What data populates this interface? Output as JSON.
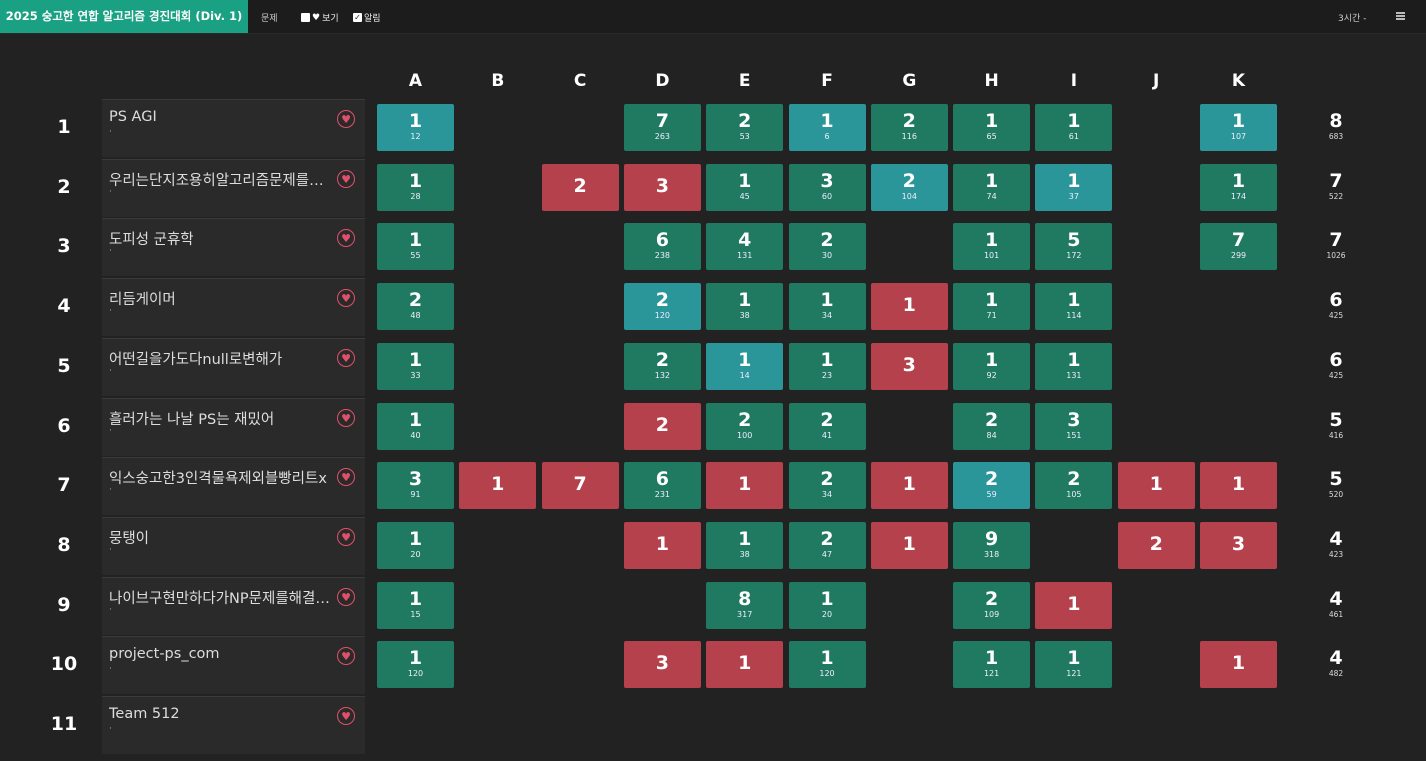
{
  "header": {
    "contest_title": "2025 숭고한 연합 알고리즘 경진대회 (Div. 1)",
    "problems_label": "문제",
    "view_label": "보기",
    "alert_label": "알림",
    "time_select": "3시간 -"
  },
  "problems": [
    "A",
    "B",
    "C",
    "D",
    "E",
    "F",
    "G",
    "H",
    "I",
    "J",
    "K"
  ],
  "rows": [
    {
      "rank": "1",
      "team": "PS AGI",
      "sub": "·",
      "solved": "8",
      "penalty": "683",
      "cells": [
        {
          "s": "first",
          "t": "1",
          "m": "12"
        },
        null,
        null,
        {
          "s": "solved",
          "t": "7",
          "m": "263"
        },
        {
          "s": "solved",
          "t": "2",
          "m": "53"
        },
        {
          "s": "first",
          "t": "1",
          "m": "6"
        },
        {
          "s": "solved",
          "t": "2",
          "m": "116"
        },
        {
          "s": "solved",
          "t": "1",
          "m": "65"
        },
        {
          "s": "solved",
          "t": "1",
          "m": "61"
        },
        null,
        {
          "s": "first",
          "t": "1",
          "m": "107"
        }
      ]
    },
    {
      "rank": "2",
      "team": "우리는단지조용히알고리즘문제를풀고싶었을뿐",
      "sub": "·",
      "solved": "7",
      "penalty": "522",
      "cells": [
        {
          "s": "solved",
          "t": "1",
          "m": "28"
        },
        null,
        {
          "s": "failed",
          "t": "2"
        },
        {
          "s": "failed",
          "t": "3"
        },
        {
          "s": "solved",
          "t": "1",
          "m": "45"
        },
        {
          "s": "solved",
          "t": "3",
          "m": "60"
        },
        {
          "s": "first",
          "t": "2",
          "m": "104"
        },
        {
          "s": "solved",
          "t": "1",
          "m": "74"
        },
        {
          "s": "first",
          "t": "1",
          "m": "37"
        },
        null,
        {
          "s": "solved",
          "t": "1",
          "m": "174"
        }
      ]
    },
    {
      "rank": "3",
      "team": "도피성 군휴학",
      "sub": "·",
      "solved": "7",
      "penalty": "1026",
      "cells": [
        {
          "s": "solved",
          "t": "1",
          "m": "55"
        },
        null,
        null,
        {
          "s": "solved",
          "t": "6",
          "m": "238"
        },
        {
          "s": "solved",
          "t": "4",
          "m": "131"
        },
        {
          "s": "solved",
          "t": "2",
          "m": "30"
        },
        null,
        {
          "s": "solved",
          "t": "1",
          "m": "101"
        },
        {
          "s": "solved",
          "t": "5",
          "m": "172"
        },
        null,
        {
          "s": "solved",
          "t": "7",
          "m": "299"
        }
      ]
    },
    {
      "rank": "4",
      "team": "리듬게이머",
      "sub": "·",
      "solved": "6",
      "penalty": "425",
      "cells": [
        {
          "s": "solved",
          "t": "2",
          "m": "48"
        },
        null,
        null,
        {
          "s": "first",
          "t": "2",
          "m": "120"
        },
        {
          "s": "solved",
          "t": "1",
          "m": "38"
        },
        {
          "s": "solved",
          "t": "1",
          "m": "34"
        },
        {
          "s": "failed",
          "t": "1"
        },
        {
          "s": "solved",
          "t": "1",
          "m": "71"
        },
        {
          "s": "solved",
          "t": "1",
          "m": "114"
        },
        null,
        null
      ]
    },
    {
      "rank": "5",
      "team": "어떤길을가도다null로변해가",
      "sub": "·",
      "solved": "6",
      "penalty": "425",
      "cells": [
        {
          "s": "solved",
          "t": "1",
          "m": "33"
        },
        null,
        null,
        {
          "s": "solved",
          "t": "2",
          "m": "132"
        },
        {
          "s": "first",
          "t": "1",
          "m": "14"
        },
        {
          "s": "solved",
          "t": "1",
          "m": "23"
        },
        {
          "s": "failed",
          "t": "3"
        },
        {
          "s": "solved",
          "t": "1",
          "m": "92"
        },
        {
          "s": "solved",
          "t": "1",
          "m": "131"
        },
        null,
        null
      ]
    },
    {
      "rank": "6",
      "team": "흘러가는 나날 PS는 재밌어",
      "sub": "·",
      "solved": "5",
      "penalty": "416",
      "cells": [
        {
          "s": "solved",
          "t": "1",
          "m": "40"
        },
        null,
        null,
        {
          "s": "failed",
          "t": "2"
        },
        {
          "s": "solved",
          "t": "2",
          "m": "100"
        },
        {
          "s": "solved",
          "t": "2",
          "m": "41"
        },
        null,
        {
          "s": "solved",
          "t": "2",
          "m": "84"
        },
        {
          "s": "solved",
          "t": "3",
          "m": "151"
        },
        null,
        null
      ]
    },
    {
      "rank": "7",
      "team": "익스숭고한3인격물욕제외블빵리트x",
      "sub": "·",
      "solved": "5",
      "penalty": "520",
      "cells": [
        {
          "s": "solved",
          "t": "3",
          "m": "91"
        },
        {
          "s": "failed",
          "t": "1"
        },
        {
          "s": "failed",
          "t": "7"
        },
        {
          "s": "solved",
          "t": "6",
          "m": "231"
        },
        {
          "s": "failed",
          "t": "1"
        },
        {
          "s": "solved",
          "t": "2",
          "m": "34"
        },
        {
          "s": "failed",
          "t": "1"
        },
        {
          "s": "first",
          "t": "2",
          "m": "59"
        },
        {
          "s": "solved",
          "t": "2",
          "m": "105"
        },
        {
          "s": "failed",
          "t": "1"
        },
        {
          "s": "failed",
          "t": "1"
        }
      ]
    },
    {
      "rank": "8",
      "team": "뭉탱이",
      "sub": "·",
      "solved": "4",
      "penalty": "423",
      "cells": [
        {
          "s": "solved",
          "t": "1",
          "m": "20"
        },
        null,
        null,
        {
          "s": "failed",
          "t": "1"
        },
        {
          "s": "solved",
          "t": "1",
          "m": "38"
        },
        {
          "s": "solved",
          "t": "2",
          "m": "47"
        },
        {
          "s": "failed",
          "t": "1"
        },
        {
          "s": "solved",
          "t": "9",
          "m": "318"
        },
        null,
        {
          "s": "failed",
          "t": "2"
        },
        {
          "s": "failed",
          "t": "3"
        }
      ]
    },
    {
      "rank": "9",
      "team": "나이브구현만하다가NP문제를해결했다",
      "sub": "·",
      "solved": "4",
      "penalty": "461",
      "cells": [
        {
          "s": "solved",
          "t": "1",
          "m": "15"
        },
        null,
        null,
        null,
        {
          "s": "solved",
          "t": "8",
          "m": "317"
        },
        {
          "s": "solved",
          "t": "1",
          "m": "20"
        },
        null,
        {
          "s": "solved",
          "t": "2",
          "m": "109"
        },
        {
          "s": "failed",
          "t": "1"
        },
        null,
        null
      ]
    },
    {
      "rank": "10",
      "team": "project-ps_com",
      "sub": "·",
      "solved": "4",
      "penalty": "482",
      "cells": [
        {
          "s": "solved",
          "t": "1",
          "m": "120"
        },
        null,
        null,
        {
          "s": "failed",
          "t": "3"
        },
        {
          "s": "failed",
          "t": "1"
        },
        {
          "s": "solved",
          "t": "1",
          "m": "120"
        },
        null,
        {
          "s": "solved",
          "t": "1",
          "m": "121"
        },
        {
          "s": "solved",
          "t": "1",
          "m": "121"
        },
        null,
        {
          "s": "failed",
          "t": "1"
        }
      ]
    },
    {
      "rank": "11",
      "team": "Team 512",
      "sub": "·",
      "solved": "",
      "penalty": "",
      "cells": []
    }
  ],
  "colors": {
    "solved": "#207a62",
    "first_solve": "#2a969a",
    "failed": "#b5414d",
    "brand": "#1aa082",
    "favorite": "#e0506a"
  }
}
